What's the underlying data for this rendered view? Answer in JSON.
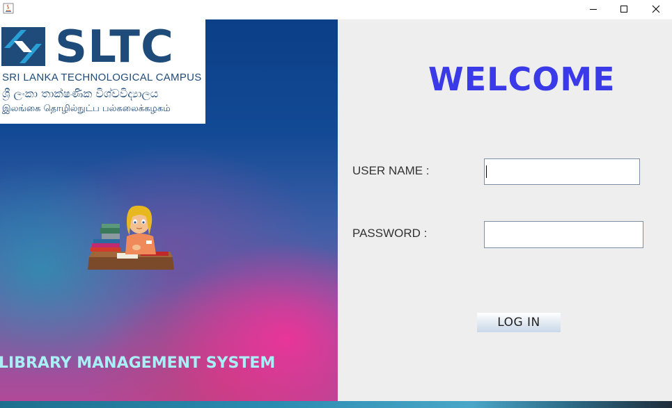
{
  "titlebar": {
    "app_icon": "java-icon",
    "minimize_icon": "minimize-icon",
    "maximize_icon": "maximize-icon",
    "close_icon": "close-icon"
  },
  "logo": {
    "wordmark": "SLTC",
    "subtitle_en": "SRI LANKA TECHNOLOGICAL CAMPUS",
    "subtitle_si": "ශ්‍රී ලංකා තාක්ෂණික විශ්වවිද්‍යාලය",
    "subtitle_ta": "இலங்கை தொழில்நுட்ப பல்கலைக்கழகம்",
    "brand_color": "#1e4b7a",
    "mark_color": "#2a9fd6"
  },
  "left": {
    "illustration": "librarian-reading-illustration",
    "system_title": "LIBRARY MANAGEMENT SYSTEM"
  },
  "login": {
    "welcome": "WELCOME",
    "welcome_color": "#3b3ae8",
    "username_label": "USER NAME :",
    "username_value": "",
    "password_label": "PASSWORD :",
    "password_value": "",
    "login_button": "LOG IN"
  }
}
